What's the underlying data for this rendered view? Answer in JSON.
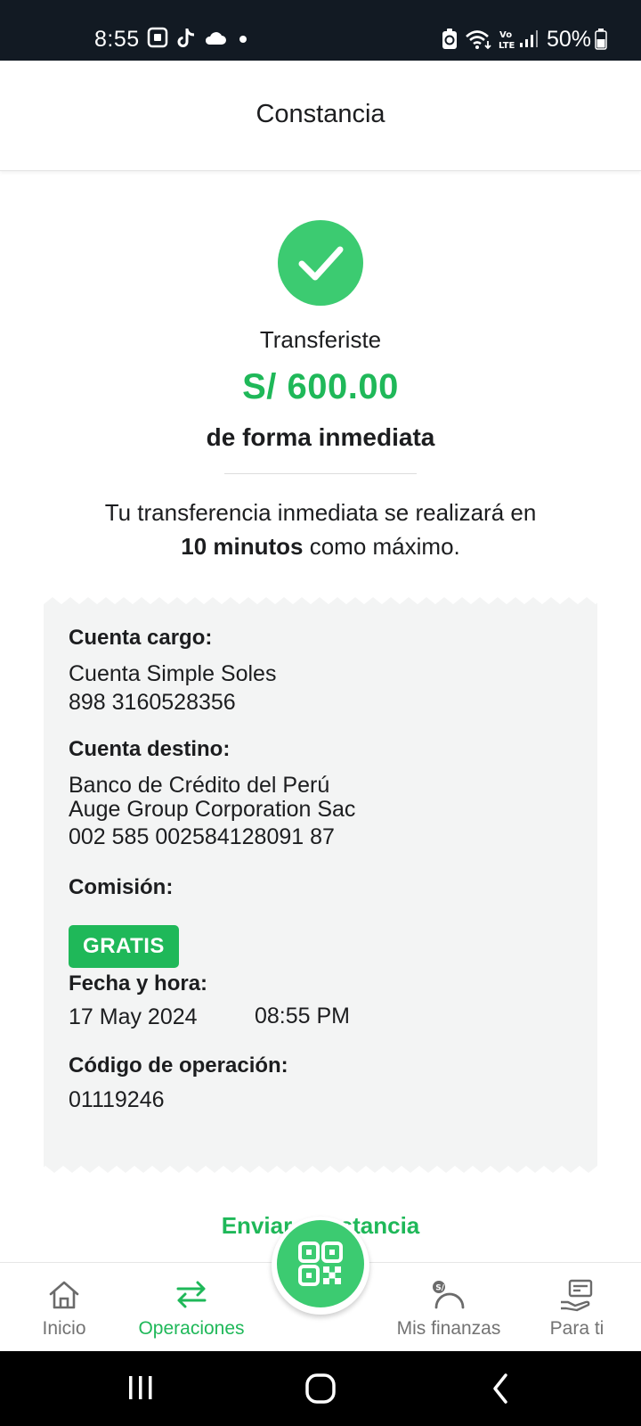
{
  "status_bar": {
    "time": "8:55",
    "battery": "50%",
    "icons": [
      "screenshot-icon",
      "tiktok-icon",
      "cloud-icon",
      "notification-dot-icon",
      "battery-saver-icon",
      "wifi-icon",
      "volte-icon",
      "signal-icon",
      "battery-icon"
    ]
  },
  "header": {
    "title": "Constancia"
  },
  "summary": {
    "label": "Transferiste",
    "amount": "S/ 600.00",
    "subtitle": "de forma inmediata",
    "note_line1": "Tu transferencia inmediata se realizará en",
    "note_bold": "10 minutos",
    "note_rest": " como máximo."
  },
  "receipt": {
    "cuenta_cargo_label": "Cuenta cargo:",
    "cuenta_cargo_name": "Cuenta Simple Soles",
    "cuenta_cargo_number": "898 3160528356",
    "cuenta_destino_label": "Cuenta destino:",
    "cuenta_destino_bank": "Banco de Crédito del Perú",
    "cuenta_destino_holder": "Auge Group Corporation Sac",
    "cuenta_destino_number": "002 585 002584128091 87",
    "comision_label": "Comisión:",
    "comision_value": "GRATIS",
    "fecha_label": "Fecha y hora:",
    "fecha_date": "17 May 2024",
    "fecha_time": "08:55 PM",
    "codigo_label": "Código de operación:",
    "codigo_value": "01119246"
  },
  "send_link": "Enviar constancia",
  "bottom_nav": {
    "items": [
      {
        "label": "Inicio",
        "icon": "home-icon",
        "active": false
      },
      {
        "label": "Operaciones",
        "icon": "transfer-arrows-icon",
        "active": true
      },
      {
        "label": "Mis finanzas",
        "icon": "finance-gauge-icon",
        "active": false
      },
      {
        "label": "Para ti",
        "icon": "offer-hand-icon",
        "active": false
      }
    ],
    "fab_icon": "qr-code-icon"
  },
  "colors": {
    "accent_green": "#1fb859",
    "success_green": "#3ccb71",
    "status_bar_bg": "#121a23",
    "receipt_bg": "#f3f4f4"
  }
}
